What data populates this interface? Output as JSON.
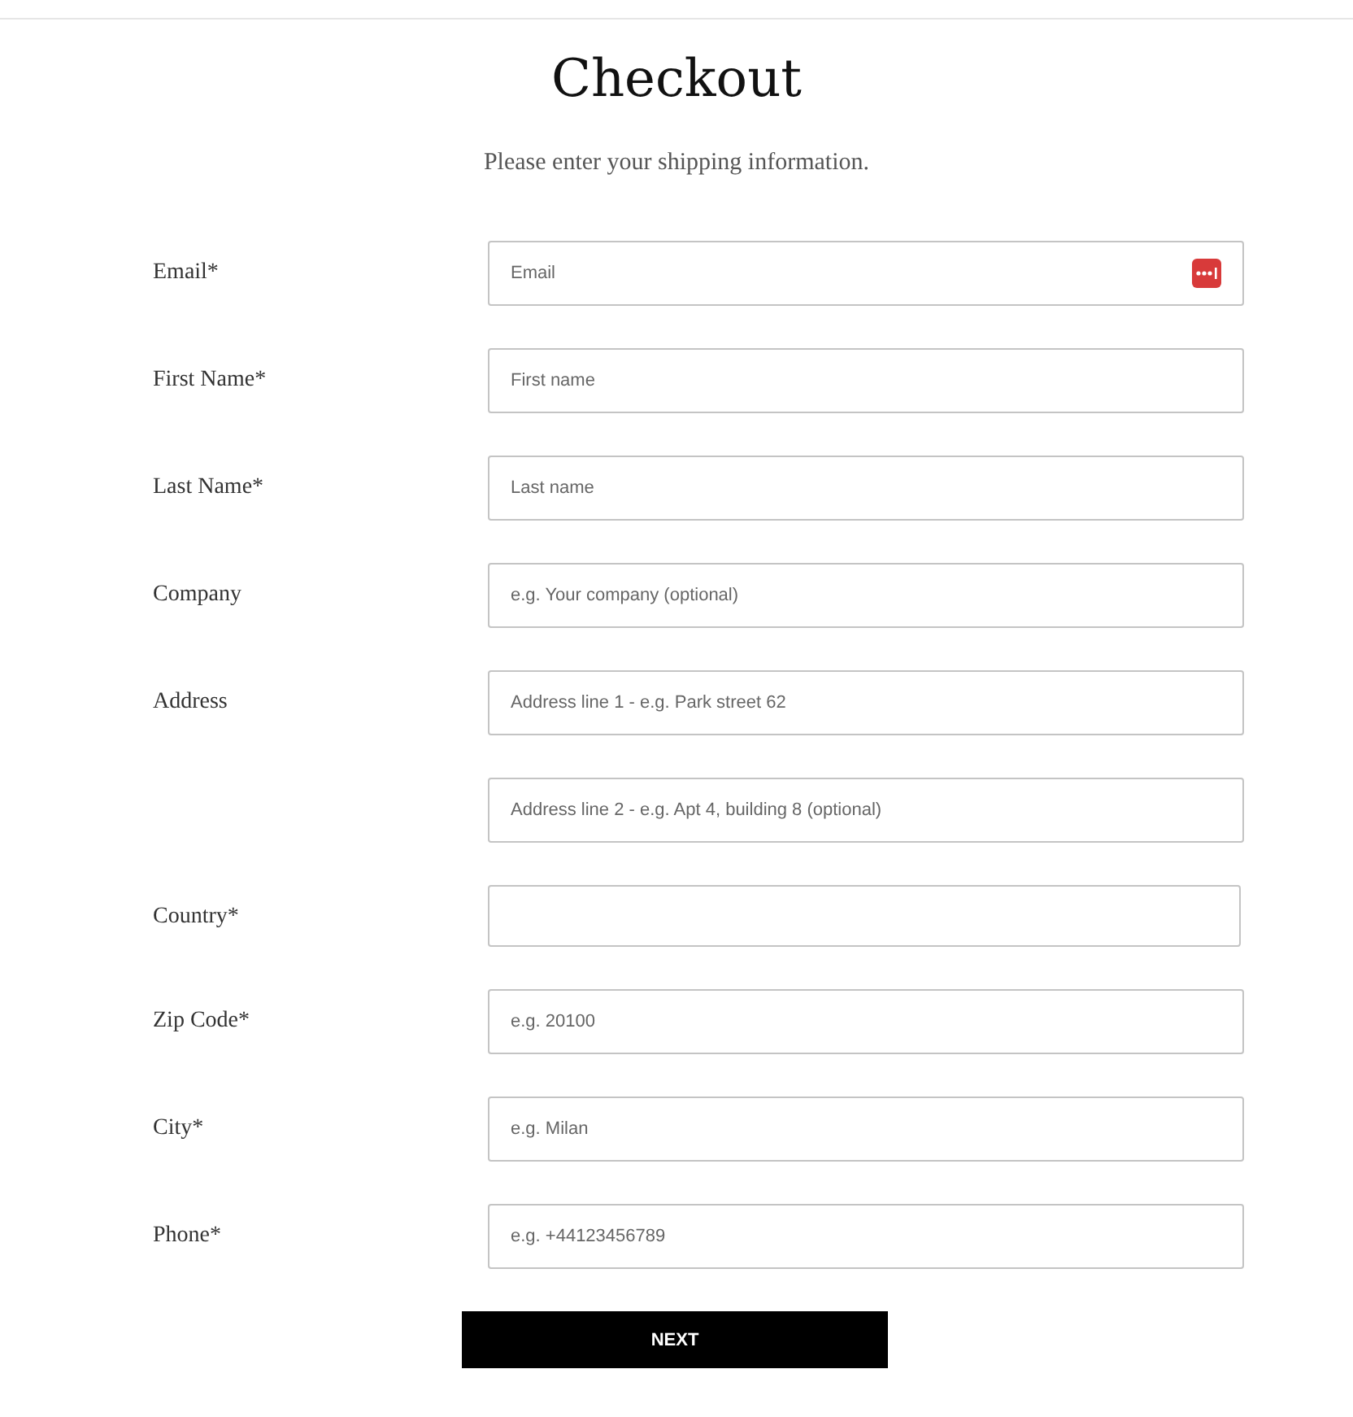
{
  "title": "Checkout",
  "subtitle": "Please enter your shipping information.",
  "fields": [
    {
      "label": "Email*",
      "placeholder": "Email",
      "kind": "text",
      "autofill_icon": true
    },
    {
      "label": "First Name*",
      "placeholder": "First name",
      "kind": "text",
      "autofill_icon": false
    },
    {
      "label": "Last Name*",
      "placeholder": "Last name",
      "kind": "text",
      "autofill_icon": false
    },
    {
      "label": "Company",
      "placeholder": "e.g. Your company (optional)",
      "kind": "text",
      "autofill_icon": false
    },
    {
      "label": "Address",
      "placeholder": "Address line 1 - e.g. Park street 62",
      "kind": "text",
      "autofill_icon": false
    },
    {
      "placeholder": "Address line 2 - e.g. Apt 4, building 8 (optional)",
      "kind": "text",
      "autofill_icon": false
    },
    {
      "label": "Country*",
      "kind": "select"
    },
    {
      "label": "Zip Code*",
      "placeholder": "e.g. 20100",
      "kind": "text",
      "autofill_icon": false
    },
    {
      "label": "City*",
      "placeholder": "e.g. Milan",
      "kind": "text",
      "autofill_icon": false
    },
    {
      "label": "Phone*",
      "placeholder": "e.g. +44123456789",
      "kind": "text",
      "autofill_icon": false
    }
  ],
  "button": "NEXT"
}
